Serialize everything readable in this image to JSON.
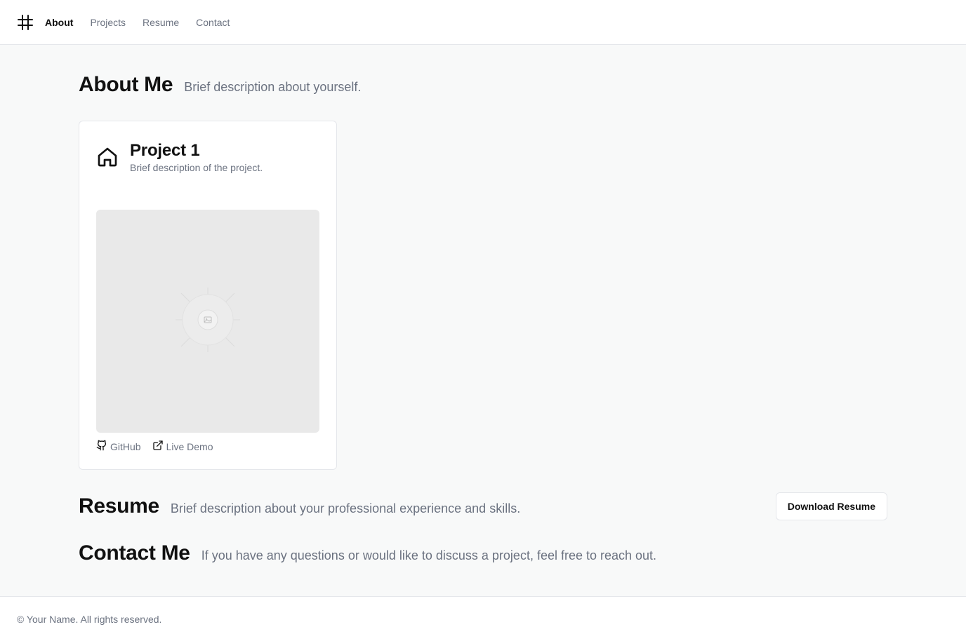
{
  "nav": {
    "logo_icon": "hash-icon",
    "items": [
      {
        "label": "About",
        "active": true
      },
      {
        "label": "Projects",
        "active": false
      },
      {
        "label": "Resume",
        "active": false
      },
      {
        "label": "Contact",
        "active": false
      }
    ]
  },
  "about": {
    "title": "About Me",
    "description": "Brief description about yourself."
  },
  "projects": [
    {
      "icon": "home-icon",
      "title": "Project 1",
      "description": "Brief description of the project.",
      "image_icon": "image-placeholder-icon",
      "links": [
        {
          "label": "GitHub",
          "icon": "github-icon"
        },
        {
          "label": "Live Demo",
          "icon": "external-link-icon"
        }
      ]
    }
  ],
  "resume": {
    "title": "Resume",
    "description": "Brief description about your professional experience and skills.",
    "download_label": "Download Resume"
  },
  "contact": {
    "title": "Contact Me",
    "description": "If you have any questions or would like to discuss a project, feel free to reach out."
  },
  "footer": {
    "text": "© Your Name. All rights reserved."
  },
  "colors": {
    "page_bg": "#f8f9f9",
    "muted_text": "#6b7280",
    "border": "#e5e7eb",
    "placeholder_bg": "#e9e9e9"
  }
}
